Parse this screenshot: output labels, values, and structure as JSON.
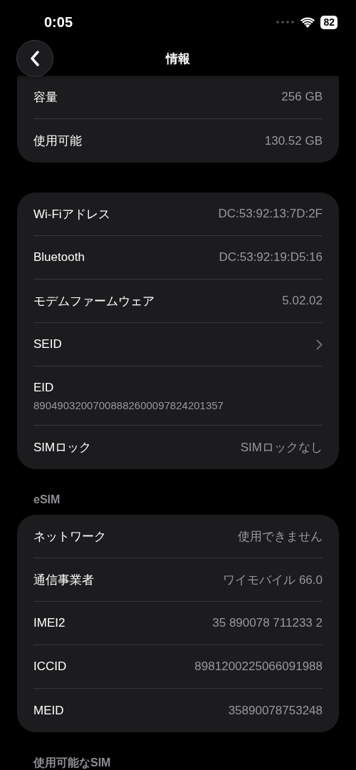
{
  "status_bar": {
    "time": "0:05",
    "battery": "82"
  },
  "nav": {
    "title": "情報"
  },
  "sections": [
    {
      "rows": [
        {
          "kind": "value",
          "label": "容量",
          "value": "256 GB"
        },
        {
          "kind": "value",
          "label": "使用可能",
          "value": "130.52 GB"
        }
      ]
    },
    {
      "rows": [
        {
          "kind": "value",
          "label": "Wi-Fiアドレス",
          "value": "DC:53:92:13:7D:2F"
        },
        {
          "kind": "value",
          "label": "Bluetooth",
          "value": "DC:53:92:19:D5:16"
        },
        {
          "kind": "value",
          "label": "モデムファームウェア",
          "value": "5.02.02"
        },
        {
          "kind": "link",
          "label": "SEID"
        },
        {
          "kind": "stacked",
          "label": "EID",
          "value": "89049032007008882600097824201357"
        },
        {
          "kind": "value",
          "label": "SIMロック",
          "value": "SIMロックなし"
        }
      ]
    },
    {
      "header": "eSIM",
      "rows": [
        {
          "kind": "value",
          "label": "ネットワーク",
          "value": "使用できません"
        },
        {
          "kind": "value",
          "label": "通信事業者",
          "value": "ワイモバイル 66.0"
        },
        {
          "kind": "value",
          "label": "IMEI2",
          "value": "35 890078 711233 2"
        },
        {
          "kind": "value",
          "label": "ICCID",
          "value": "8981200225066091988"
        },
        {
          "kind": "value",
          "label": "MEID",
          "value": "35890078753248"
        }
      ]
    },
    {
      "header": "使用可能なSIM"
    }
  ]
}
